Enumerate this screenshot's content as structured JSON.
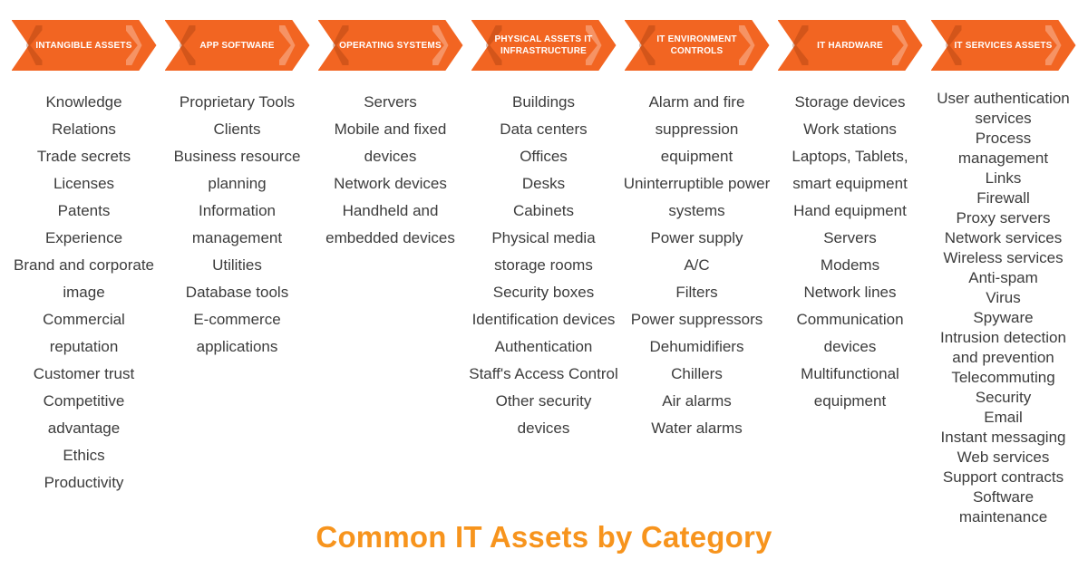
{
  "title": "Common IT Assets by Category",
  "colors": {
    "header_fill": "#f26522",
    "title_color": "#f7941d",
    "item_text": "#3c3c3c",
    "background": "#ffffff"
  },
  "columns": [
    {
      "id": "intangible-assets",
      "header": "INTANGIBLE ASSETS",
      "items": [
        "Knowledge",
        "Relations",
        "Trade secrets",
        "Licenses",
        "Patents",
        "Experience",
        "Brand and corporate image",
        "Commercial reputation",
        "Customer trust",
        "Competitive advantage",
        "Ethics",
        "Productivity"
      ]
    },
    {
      "id": "app-software",
      "header": "APP SOFTWARE",
      "items": [
        "Proprietary Tools",
        "Clients",
        "Business resource planning",
        "Information management",
        "Utilities",
        "Database tools",
        "E-commerce applications"
      ]
    },
    {
      "id": "operating-systems",
      "header": "OPERATING SYSTEMS",
      "items": [
        "Servers",
        "Mobile and fixed devices",
        "Network devices",
        "Handheld and embedded devices"
      ]
    },
    {
      "id": "physical-assets-it-infrastructure",
      "header": "PHYSICAL ASSETS IT\nINFRASTRUCTURE",
      "items": [
        "Buildings",
        "Data centers",
        "Offices",
        "Desks",
        "Cabinets",
        "Physical media storage rooms",
        "Security boxes",
        "Identification devices",
        "Authentication",
        "Staff's Access Control",
        "Other security devices"
      ]
    },
    {
      "id": "it-environment-controls",
      "header": "IT ENVIRONMENT\nCONTROLS",
      "items": [
        "Alarm and fire suppression equipment",
        "Uninterruptible power systems",
        "Power supply",
        "A/C",
        "Filters",
        "Power suppressors",
        "Dehumidifiers",
        "Chillers",
        "Air alarms",
        "Water alarms"
      ]
    },
    {
      "id": "it-hardware",
      "header": "IT HARDWARE",
      "items": [
        "Storage devices",
        "Work stations",
        "Laptops, Tablets, smart equipment",
        "Hand equipment",
        "Servers",
        "Modems",
        "Network lines",
        "Communication devices",
        "Multifunctional equipment"
      ]
    },
    {
      "id": "it-services-assets",
      "header": "IT SERVICES ASSETS",
      "items": [
        "User authentication services",
        "Process management",
        "Links",
        "Firewall",
        "Proxy servers",
        "Network services",
        "Wireless services",
        "Anti-spam",
        "Virus",
        "Spyware",
        "Intrusion detection and prevention",
        "Telecommuting",
        "Security",
        "Email",
        "Instant messaging",
        "Web services",
        "Support contracts",
        "Software maintenance"
      ]
    }
  ]
}
